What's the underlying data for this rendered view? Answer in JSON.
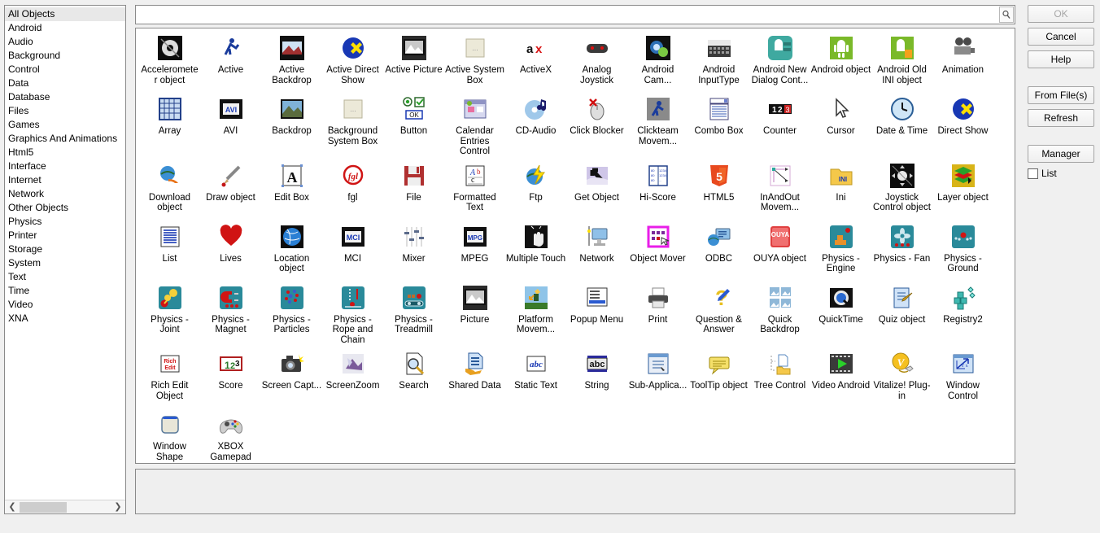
{
  "sidebar": {
    "selected": "All Objects",
    "items": [
      {
        "label": "All Objects"
      },
      {
        "label": "Android"
      },
      {
        "label": "Audio"
      },
      {
        "label": "Background"
      },
      {
        "label": "Control"
      },
      {
        "label": "Data"
      },
      {
        "label": "Database"
      },
      {
        "label": "Files"
      },
      {
        "label": "Games"
      },
      {
        "label": "Graphics And Animations"
      },
      {
        "label": "Html5"
      },
      {
        "label": "Interface"
      },
      {
        "label": "Internet"
      },
      {
        "label": "Network"
      },
      {
        "label": "Other Objects"
      },
      {
        "label": "Physics"
      },
      {
        "label": "Printer"
      },
      {
        "label": "Storage"
      },
      {
        "label": "System"
      },
      {
        "label": "Text"
      },
      {
        "label": "Time"
      },
      {
        "label": "Video"
      },
      {
        "label": "XNA"
      }
    ]
  },
  "search": {
    "value": "",
    "placeholder": "",
    "icon": "magnifier-icon"
  },
  "buttons": {
    "ok": "OK",
    "ok_disabled": true,
    "cancel": "Cancel",
    "help": "Help",
    "from_files": "From File(s)",
    "refresh": "Refresh",
    "manager": "Manager",
    "list_checkbox_label": "List",
    "list_checked": false
  },
  "objects": [
    {
      "label": "Accelerometer object",
      "icon": "accelerometer-icon"
    },
    {
      "label": "Active",
      "icon": "active-runner-icon"
    },
    {
      "label": "Active Backdrop",
      "icon": "active-backdrop-icon"
    },
    {
      "label": "Active Direct Show",
      "icon": "direct-show-icon"
    },
    {
      "label": "Active Picture",
      "icon": "picture-icon"
    },
    {
      "label": "Active System Box",
      "icon": "system-box-icon"
    },
    {
      "label": "ActiveX",
      "icon": "activex-icon"
    },
    {
      "label": "Analog Joystick",
      "icon": "gamepad-icon"
    },
    {
      "label": "Android Cam...",
      "icon": "android-camera-icon"
    },
    {
      "label": "Android InputType",
      "icon": "keyboard-icon"
    },
    {
      "label": "Android New Dialog Cont...",
      "icon": "android-dialog-icon"
    },
    {
      "label": "Android object",
      "icon": "android-robot-icon"
    },
    {
      "label": "Android Old INI object",
      "icon": "android-ini-icon"
    },
    {
      "label": "Animation",
      "icon": "film-camera-icon"
    },
    {
      "label": "Array",
      "icon": "array-grid-icon"
    },
    {
      "label": "AVI",
      "icon": "avi-film-icon"
    },
    {
      "label": "Backdrop",
      "icon": "backdrop-photo-icon"
    },
    {
      "label": "Background System Box",
      "icon": "system-box-icon"
    },
    {
      "label": "Button",
      "icon": "button-ok-icon"
    },
    {
      "label": "Calendar Entries Control",
      "icon": "calendar-icon"
    },
    {
      "label": "CD-Audio",
      "icon": "cd-audio-icon"
    },
    {
      "label": "Click Blocker",
      "icon": "click-blocker-icon"
    },
    {
      "label": "Clickteam Movem...",
      "icon": "clickteam-movement-icon"
    },
    {
      "label": "Combo Box",
      "icon": "combo-box-icon"
    },
    {
      "label": "Counter",
      "icon": "counter-icon"
    },
    {
      "label": "Cursor",
      "icon": "cursor-icon"
    },
    {
      "label": "Date & Time",
      "icon": "clock-icon"
    },
    {
      "label": "Direct Show",
      "icon": "direct-show-icon"
    },
    {
      "label": "Download object",
      "icon": "download-globe-icon"
    },
    {
      "label": "Draw object",
      "icon": "paintbrush-icon"
    },
    {
      "label": "Edit Box",
      "icon": "edit-box-icon"
    },
    {
      "label": "fgl",
      "icon": "fgl-icon"
    },
    {
      "label": "File",
      "icon": "floppy-disk-icon"
    },
    {
      "label": "Formatted Text",
      "icon": "formatted-text-icon"
    },
    {
      "label": "Ftp",
      "icon": "ftp-globe-icon"
    },
    {
      "label": "Get Object",
      "icon": "get-object-arrow-icon"
    },
    {
      "label": "Hi-Score",
      "icon": "hi-score-icon"
    },
    {
      "label": "HTML5",
      "icon": "html5-icon"
    },
    {
      "label": "InAndOut Movem...",
      "icon": "inandout-movement-icon"
    },
    {
      "label": "Ini",
      "icon": "ini-folder-icon"
    },
    {
      "label": "Joystick Control object",
      "icon": "joystick-ball-icon"
    },
    {
      "label": "Layer object",
      "icon": "layer-icon"
    },
    {
      "label": "List",
      "icon": "list-icon"
    },
    {
      "label": "Lives",
      "icon": "heart-icon"
    },
    {
      "label": "Location object",
      "icon": "globe-icon"
    },
    {
      "label": "MCI",
      "icon": "mci-film-icon"
    },
    {
      "label": "Mixer",
      "icon": "mixer-sliders-icon"
    },
    {
      "label": "MPEG",
      "icon": "mpeg-film-icon"
    },
    {
      "label": "Multiple Touch",
      "icon": "touch-hand-icon"
    },
    {
      "label": "Network",
      "icon": "network-monitor-icon"
    },
    {
      "label": "Object Mover",
      "icon": "object-mover-icon"
    },
    {
      "label": "ODBC",
      "icon": "odbc-icon"
    },
    {
      "label": "OUYA object",
      "icon": "ouya-icon"
    },
    {
      "label": "Physics - Engine",
      "icon": "physics-engine-icon"
    },
    {
      "label": "Physics - Fan",
      "icon": "physics-fan-icon"
    },
    {
      "label": "Physics - Ground",
      "icon": "physics-ground-icon"
    },
    {
      "label": "Physics - Joint",
      "icon": "physics-joint-icon"
    },
    {
      "label": "Physics - Magnet",
      "icon": "physics-magnet-icon"
    },
    {
      "label": "Physics - Particles",
      "icon": "physics-particles-icon"
    },
    {
      "label": "Physics - Rope and Chain",
      "icon": "physics-rope-icon"
    },
    {
      "label": "Physics - Treadmill",
      "icon": "physics-treadmill-icon"
    },
    {
      "label": "Picture",
      "icon": "picture-icon"
    },
    {
      "label": "Platform Movem...",
      "icon": "platform-movement-icon"
    },
    {
      "label": "Popup Menu",
      "icon": "popup-menu-icon"
    },
    {
      "label": "Print",
      "icon": "printer-icon"
    },
    {
      "label": "Question & Answer",
      "icon": "question-mark-icon"
    },
    {
      "label": "Quick Backdrop",
      "icon": "quick-backdrop-icon"
    },
    {
      "label": "QuickTime",
      "icon": "quicktime-icon"
    },
    {
      "label": "Quiz object",
      "icon": "quiz-icon"
    },
    {
      "label": "Registry2",
      "icon": "registry-icon"
    },
    {
      "label": "Rich Edit Object",
      "icon": "rich-edit-icon"
    },
    {
      "label": "Score",
      "icon": "score-icon"
    },
    {
      "label": "Screen Capt...",
      "icon": "camera-icon"
    },
    {
      "label": "ScreenZoom",
      "icon": "screen-zoom-icon"
    },
    {
      "label": "Search",
      "icon": "search-doc-icon"
    },
    {
      "label": "Shared Data",
      "icon": "shared-data-icon"
    },
    {
      "label": "Static Text",
      "icon": "static-text-icon"
    },
    {
      "label": "String",
      "icon": "string-abc-icon"
    },
    {
      "label": "Sub-Applica...",
      "icon": "sub-application-icon"
    },
    {
      "label": "ToolTip object",
      "icon": "tooltip-icon"
    },
    {
      "label": "Tree Control",
      "icon": "tree-control-icon"
    },
    {
      "label": "Video Android",
      "icon": "video-play-icon"
    },
    {
      "label": "Vitalize! Plug-in",
      "icon": "vitalize-icon"
    },
    {
      "label": "Window Control",
      "icon": "window-control-icon"
    },
    {
      "label": "Window Shape",
      "icon": "window-shape-icon"
    },
    {
      "label": "XBOX Gamepad",
      "icon": "xbox-gamepad-icon"
    }
  ]
}
